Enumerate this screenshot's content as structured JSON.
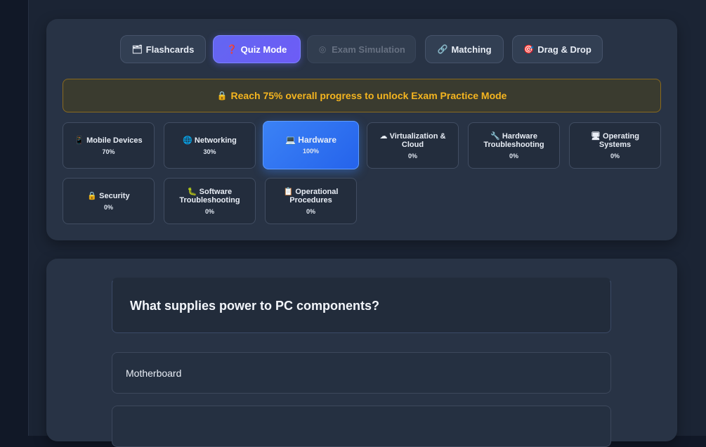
{
  "modes": [
    {
      "icon": "cards-icon",
      "glyph": "🗂",
      "label": "Flashcards",
      "state": "normal"
    },
    {
      "icon": "quiz-icon",
      "glyph": "❓",
      "label": "Quiz Mode",
      "state": "active"
    },
    {
      "icon": "target-icon",
      "glyph": "◎",
      "label": "Exam Simulation",
      "state": "disabled"
    },
    {
      "icon": "link-icon",
      "glyph": "🔗",
      "label": "Matching",
      "state": "normal"
    },
    {
      "icon": "dart-icon",
      "glyph": "🎯",
      "label": "Drag & Drop",
      "state": "normal"
    }
  ],
  "lock_banner": {
    "icon": "lock-icon",
    "glyph": "🔒",
    "text": "Reach 75% overall progress to unlock Exam Practice Mode"
  },
  "categories": [
    {
      "glyph": "📱",
      "name": "Mobile Devices",
      "progress": "70%",
      "active": false
    },
    {
      "glyph": "🌐",
      "name": "Networking",
      "progress": "30%",
      "active": false
    },
    {
      "glyph": "💻",
      "name": "Hardware",
      "progress": "100%",
      "active": true
    },
    {
      "glyph": "☁",
      "name": "Virtualization & Cloud",
      "progress": "0%",
      "active": false
    },
    {
      "glyph": "🔧",
      "name": "Hardware Troubleshooting",
      "progress": "0%",
      "active": false
    },
    {
      "glyph": "🖥",
      "name": "Operating Systems",
      "progress": "0%",
      "active": false
    },
    {
      "glyph": "🔒",
      "name": "Security",
      "progress": "0%",
      "active": false
    },
    {
      "glyph": "🐛",
      "name": "Software Troubleshooting",
      "progress": "0%",
      "active": false
    },
    {
      "glyph": "📋",
      "name": "Operational Procedures",
      "progress": "0%",
      "active": false
    }
  ],
  "question": {
    "text": "What supplies power to PC components?"
  },
  "answers": [
    "Motherboard",
    ""
  ],
  "colors": {
    "accent": "#6366f1",
    "active_category": "#3b82f6",
    "warning": "#f5b51f"
  }
}
